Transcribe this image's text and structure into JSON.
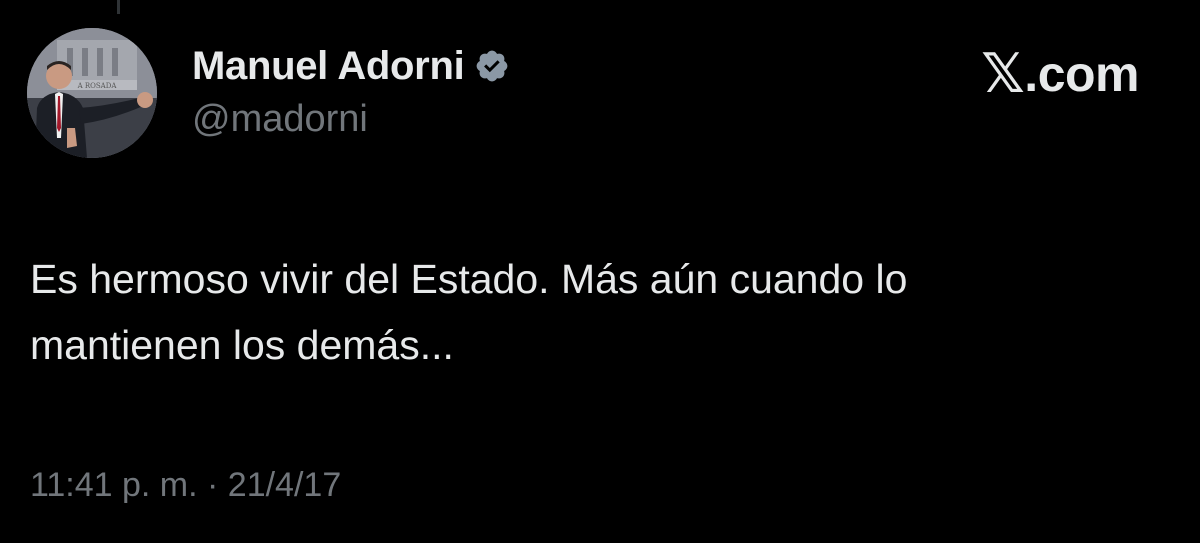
{
  "tweet": {
    "author": {
      "name": "Manuel Adorni",
      "handle": "@madorni",
      "verified": true,
      "avatar_sign_text": "A ROSADA"
    },
    "brand": {
      "x_glyph": "𝕏",
      "domain": ".com"
    },
    "text": "Es hermoso vivir del Estado. Más aún cuando lo\nmantienen los demás...",
    "timestamp": {
      "time": "11:41 p. m.",
      "separator": " · ",
      "date": "21/4/17"
    }
  },
  "colors": {
    "background": "#000000",
    "text_primary": "#e7e9ea",
    "text_secondary": "#71767b",
    "verified_badge": "#8b98a5"
  },
  "icons": {
    "verified": "verified-badge-icon",
    "brand": "x-logo-icon"
  }
}
